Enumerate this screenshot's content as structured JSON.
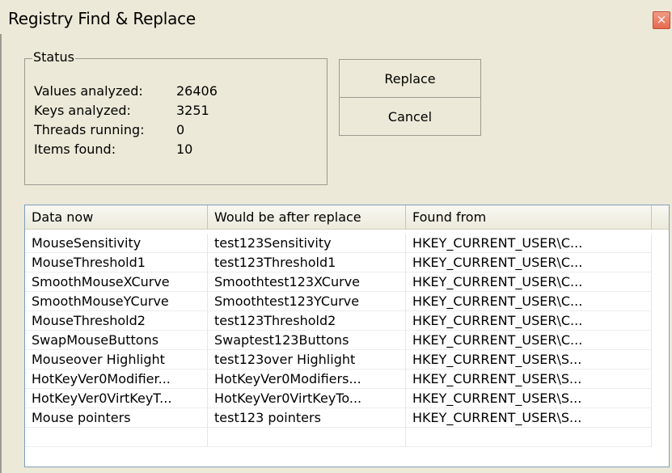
{
  "window": {
    "title": "Registry Find & Replace",
    "close_glyph": "×"
  },
  "status": {
    "legend": "Status",
    "rows": [
      {
        "label": "Values analyzed:",
        "value": "26406"
      },
      {
        "label": "Keys analyzed:",
        "value": "3251"
      },
      {
        "label": "Threads running:",
        "value": "0"
      },
      {
        "label": "Items found:",
        "value": "10"
      }
    ]
  },
  "buttons": {
    "replace": "Replace",
    "cancel": "Cancel"
  },
  "results": {
    "columns": [
      "Data now",
      "Would be after replace",
      "Found from"
    ],
    "rows": [
      [
        "MouseSensitivity",
        "test123Sensitivity",
        "HKEY_CURRENT_USER\\C..."
      ],
      [
        "MouseThreshold1",
        "test123Threshold1",
        "HKEY_CURRENT_USER\\C..."
      ],
      [
        "SmoothMouseXCurve",
        "Smoothtest123XCurve",
        "HKEY_CURRENT_USER\\C..."
      ],
      [
        "SmoothMouseYCurve",
        "Smoothtest123YCurve",
        "HKEY_CURRENT_USER\\C..."
      ],
      [
        "MouseThreshold2",
        "test123Threshold2",
        "HKEY_CURRENT_USER\\C..."
      ],
      [
        "SwapMouseButtons",
        "Swaptest123Buttons",
        "HKEY_CURRENT_USER\\C..."
      ],
      [
        "Mouseover Highlight",
        "test123over Highlight",
        "HKEY_CURRENT_USER\\S..."
      ],
      [
        "HotKeyVer0Modifier...",
        "HotKeyVer0Modifiers...",
        "HKEY_CURRENT_USER\\S..."
      ],
      [
        "HotKeyVer0VirtKeyT...",
        "HotKeyVer0VirtKeyTo...",
        "HKEY_CURRENT_USER\\S..."
      ],
      [
        "Mouse pointers",
        "test123 pointers",
        "HKEY_CURRENT_USER\\S..."
      ]
    ]
  },
  "colors": {
    "window_bg": "#ece9d8",
    "list_bg": "#ffffff",
    "close_button": "#e56a4e"
  }
}
